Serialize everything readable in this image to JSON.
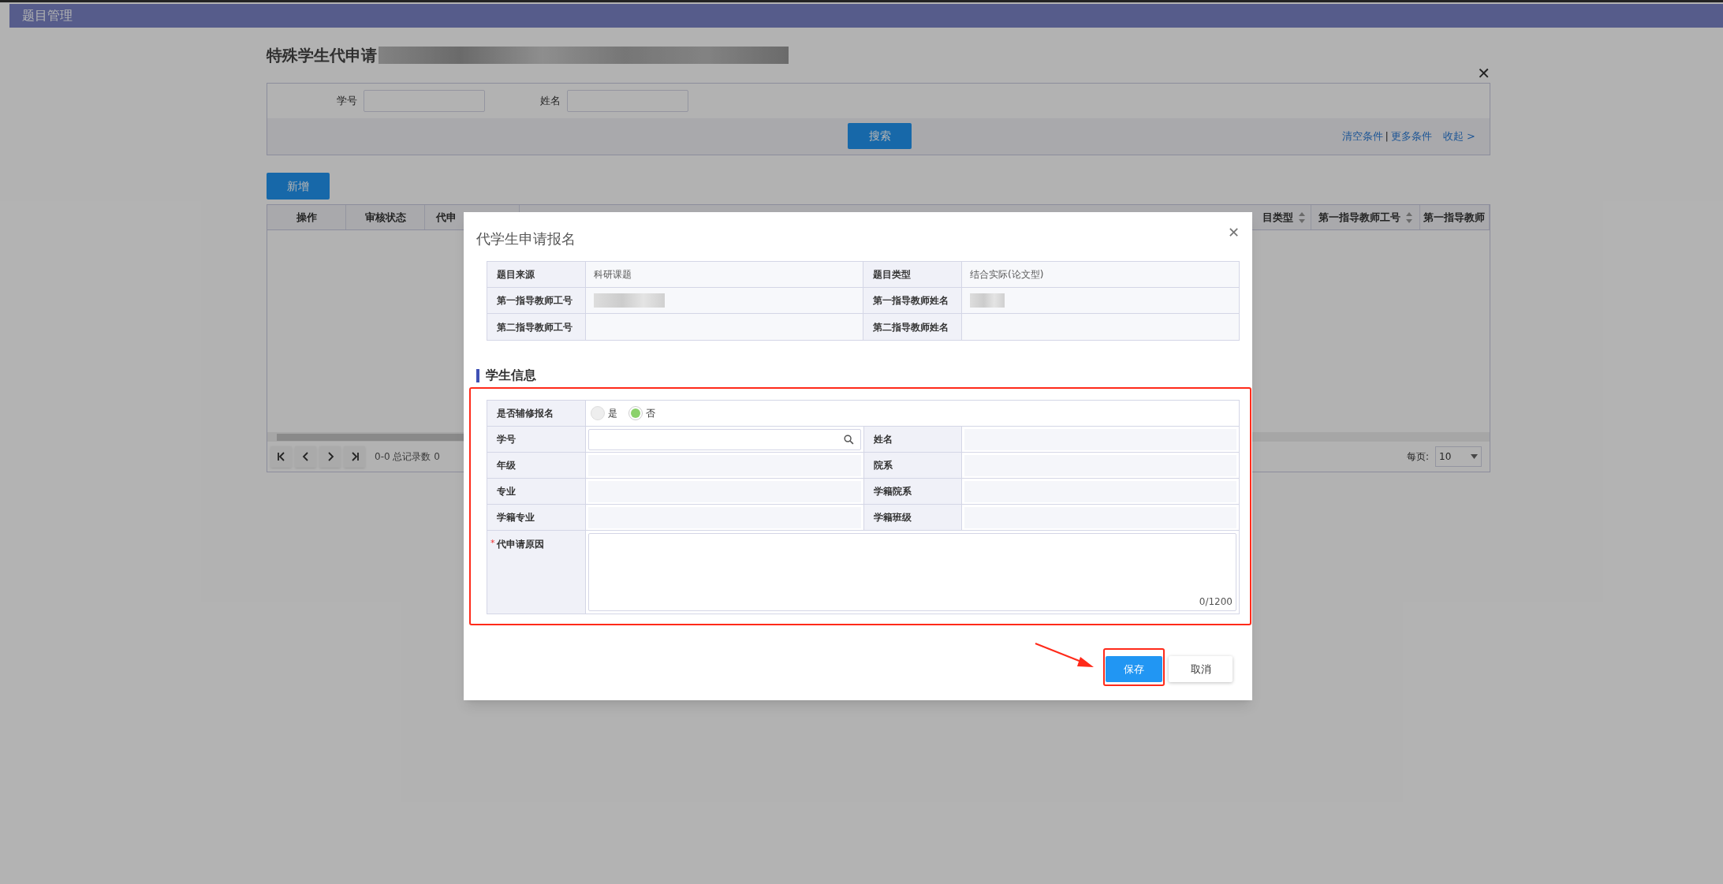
{
  "header": {
    "title": "题目管理"
  },
  "page": {
    "title": "特殊学生代申请",
    "close": "✕"
  },
  "search": {
    "fields": [
      {
        "label": "学号"
      },
      {
        "label": "姓名"
      }
    ],
    "button": "搜索",
    "links": [
      {
        "label": "清空条件"
      },
      {
        "label": "更多条件"
      }
    ],
    "separator": "|",
    "collapse": "收起 >"
  },
  "add_button": "新增",
  "table": {
    "columns": [
      {
        "label": "操作",
        "sortable": false
      },
      {
        "label": "审核状态",
        "sortable": false
      },
      {
        "label": "代申"
      },
      {
        "label": "目类型",
        "sortable": true
      },
      {
        "label": "第一指导教师工号",
        "sortable": true
      },
      {
        "label": "第一指导教师"
      }
    ]
  },
  "pagination": {
    "summary": "0-0 总记录数 0",
    "per_page_label": "每页:",
    "per_page": "10"
  },
  "dialog": {
    "title": "代学生申请报名",
    "close": "✕",
    "info": [
      {
        "label": "题目来源",
        "value": "科研课题"
      },
      {
        "label": "题目类型",
        "value": "结合实际(论文型)"
      },
      {
        "label": "第一指导教师工号",
        "redacted": true
      },
      {
        "label": "第一指导教师姓名",
        "redacted": true
      },
      {
        "label": "第二指导教师工号"
      },
      {
        "label": "第二指导教师姓名"
      }
    ],
    "section": "学生信息",
    "minor_signup": {
      "label": "是否辅修报名",
      "options": [
        {
          "label": "是",
          "selected": false
        },
        {
          "label": "否",
          "selected": true
        }
      ]
    },
    "fields": [
      {
        "label": "学号",
        "kind": "search"
      },
      {
        "label": "姓名",
        "kind": "readonly"
      },
      {
        "label": "年级",
        "kind": "readonly"
      },
      {
        "label": "院系",
        "kind": "readonly"
      },
      {
        "label": "专业",
        "kind": "readonly"
      },
      {
        "label": "学籍院系",
        "kind": "readonly"
      },
      {
        "label": "学籍专业",
        "kind": "readonly"
      },
      {
        "label": "学籍班级",
        "kind": "readonly"
      }
    ],
    "reason": {
      "label": "代申请原因",
      "required_mark": "*",
      "counter": "0/1200"
    },
    "buttons": [
      {
        "label": "保存",
        "kind": "primary"
      },
      {
        "label": "取消",
        "kind": "default"
      }
    ]
  }
}
